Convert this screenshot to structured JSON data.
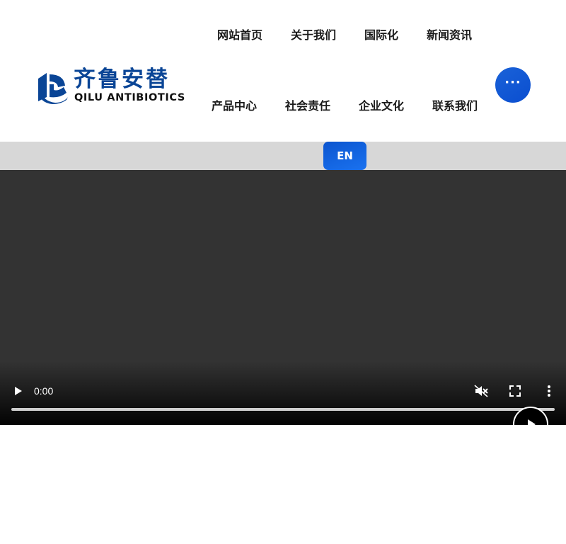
{
  "brand": {
    "name_cn": "齐鲁安替",
    "name_en": "QILU ANTIBIOTICS",
    "color": "#0a4596"
  },
  "nav": {
    "items": [
      {
        "label": "网站首页"
      },
      {
        "label": "关于我们"
      },
      {
        "label": "国际化"
      },
      {
        "label": "新闻资讯"
      },
      {
        "label": "产品中心"
      },
      {
        "label": "社会责任"
      },
      {
        "label": "企业文化"
      },
      {
        "label": "联系我们"
      }
    ],
    "more_label": "···",
    "more_icon": "ellipsis-icon",
    "accent": "#0b55cf"
  },
  "language": {
    "label": "EN",
    "bar_color": "#d7d7d7"
  },
  "video": {
    "time": "0:00",
    "muted": true,
    "progress": 0,
    "icons": [
      "play-icon",
      "mute-icon",
      "fullscreen-icon",
      "more-vertical-icon",
      "play-circle-icon"
    ]
  }
}
